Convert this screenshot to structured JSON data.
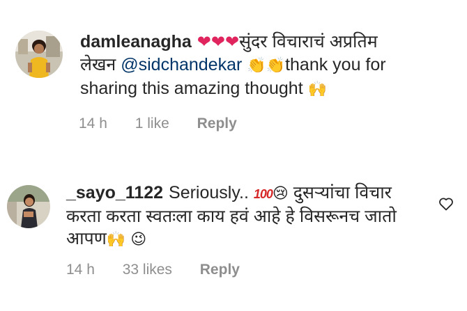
{
  "comments": [
    {
      "username": "damleanagha",
      "lines": [
        "सुंदर विचाराचं अप्रतिम",
        "लेखन",
        "thank you for",
        "sharing this amazing thought"
      ],
      "mention": "@sidchandekar",
      "time": "14 h",
      "likes": "1 like",
      "reply": "Reply"
    },
    {
      "username": "_sayo_1122",
      "lines": [
        "Seriously..",
        "दुसऱ्यांचा विचार",
        "करता करता स्वतःला काय हवं आहे हे विसरूनच जातो",
        "आपण"
      ],
      "time": "14 h",
      "likes": "33 likes",
      "reply": "Reply"
    }
  ],
  "icons": {
    "heart": "heart-icon",
    "clap": "clapping-hands-icon",
    "raised_hands": "raised-hands-icon",
    "hundred": "hundred-points-icon",
    "tear": "crying-face-icon",
    "smile": "smiling-face-icon",
    "like": "heart-outline-icon"
  },
  "colors": {
    "text": "#262626",
    "meta": "#8e8e8e",
    "mention": "#003569",
    "heart": "#e0245e"
  }
}
